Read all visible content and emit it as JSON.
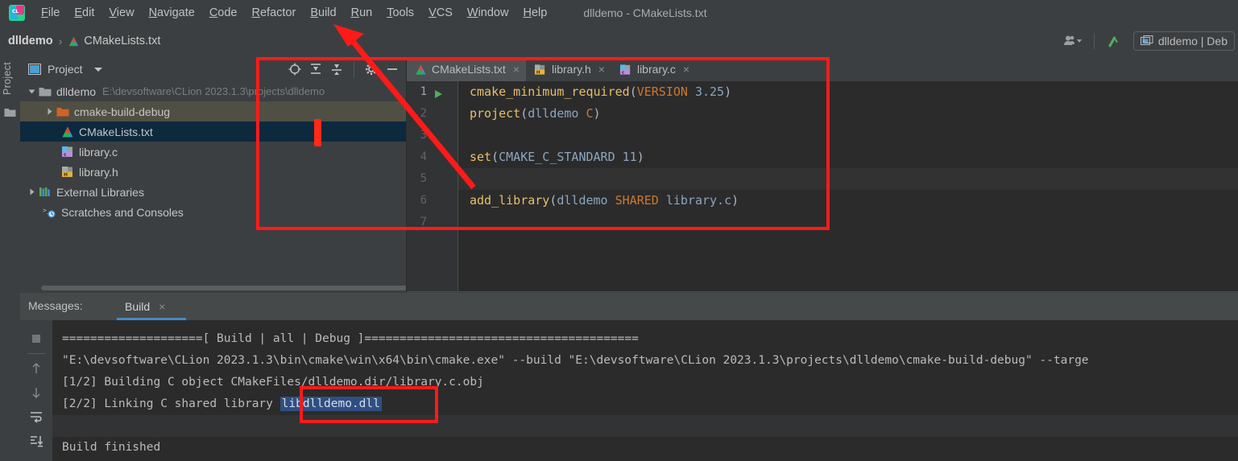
{
  "app": {
    "logo_icon": "clion-logo-icon",
    "window_title": "dlldemo - CMakeLists.txt"
  },
  "menubar": {
    "items": [
      {
        "label": "File",
        "mnemonic": "F"
      },
      {
        "label": "Edit",
        "mnemonic": "E"
      },
      {
        "label": "View",
        "mnemonic": "V"
      },
      {
        "label": "Navigate",
        "mnemonic": "N"
      },
      {
        "label": "Code",
        "mnemonic": "C"
      },
      {
        "label": "Refactor",
        "mnemonic": "R"
      },
      {
        "label": "Build",
        "mnemonic": "B"
      },
      {
        "label": "Run",
        "mnemonic": "R"
      },
      {
        "label": "Tools",
        "mnemonic": "T"
      },
      {
        "label": "VCS",
        "mnemonic": "V"
      },
      {
        "label": "Window",
        "mnemonic": "W"
      },
      {
        "label": "Help",
        "mnemonic": "H"
      }
    ]
  },
  "navbar": {
    "breadcrumbs": [
      "dlldemo",
      "CMakeLists.txt"
    ],
    "separator": "›",
    "file_icon": "cmake-file-icon",
    "right": {
      "account_icon": "account-dropdown-icon",
      "updates_icon": "green-arrow-icon",
      "run_config": {
        "icon": "run-config-icon",
        "label": "dlldemo | Deb"
      }
    }
  },
  "left_stripe": {
    "label": "Project",
    "folder_icon": "folder-icon"
  },
  "project_panel": {
    "title": "Project",
    "dropdown_icon": "chevron-down-icon",
    "view_icon": "project-view-icon",
    "toolbar": [
      {
        "name": "locate-icon",
        "glyph": "target"
      },
      {
        "name": "expand-all-icon",
        "glyph": "expand"
      },
      {
        "name": "collapse-all-icon",
        "glyph": "collapse"
      },
      {
        "name": "settings-gear-icon",
        "glyph": "gear"
      },
      {
        "name": "hide-panel-icon",
        "glyph": "minus"
      }
    ],
    "tree": [
      {
        "label": "dlldemo",
        "path": "E:\\devsoftware\\CLion 2023.1.3\\projects\\dlldemo",
        "icon": "project-folder-icon",
        "twisty": "expanded",
        "indent": 0,
        "state": "normal"
      },
      {
        "label": "cmake-build-debug",
        "path": "",
        "icon": "build-folder-icon",
        "twisty": "collapsed",
        "indent": 1,
        "state": "hover"
      },
      {
        "label": "CMakeLists.txt",
        "path": "",
        "icon": "cmake-file-icon",
        "twisty": "none",
        "indent": 2,
        "state": "selected"
      },
      {
        "label": "library.c",
        "path": "",
        "icon": "c-file-icon",
        "twisty": "none",
        "indent": 2,
        "state": "normal"
      },
      {
        "label": "library.h",
        "path": "",
        "icon": "h-file-icon",
        "twisty": "none",
        "indent": 2,
        "state": "normal"
      },
      {
        "label": "External Libraries",
        "path": "",
        "icon": "external-libraries-icon",
        "twisty": "collapsed",
        "indent": 0,
        "state": "normal"
      },
      {
        "label": "Scratches and Consoles",
        "path": "",
        "icon": "scratches-icon",
        "twisty": "none",
        "indent": 0,
        "state": "normal"
      }
    ]
  },
  "editor": {
    "tabs": [
      {
        "label": "CMakeLists.txt",
        "icon": "cmake-file-icon",
        "active": true,
        "close": "×"
      },
      {
        "label": "library.h",
        "icon": "h-file-icon",
        "active": false,
        "close": "×"
      },
      {
        "label": "library.c",
        "icon": "c-file-icon",
        "active": false,
        "close": "×"
      }
    ],
    "gutter": {
      "run_marker_icon": "run-gutter-icon",
      "line_numbers": [
        "1",
        "2",
        "3",
        "4",
        "5",
        "6",
        "7"
      ]
    },
    "lines": [
      {
        "n": 1,
        "highlight": false,
        "tokens": [
          {
            "t": "cmake_minimum_required",
            "c": "fn"
          },
          {
            "t": "(",
            "c": "p"
          },
          {
            "t": "VERSION",
            "c": "kw"
          },
          {
            "t": " ",
            "c": "p"
          },
          {
            "t": "3.25",
            "c": "num"
          },
          {
            "t": ")",
            "c": "p"
          }
        ]
      },
      {
        "n": 2,
        "highlight": false,
        "tokens": [
          {
            "t": "project",
            "c": "fn"
          },
          {
            "t": "(",
            "c": "p"
          },
          {
            "t": "dlldemo",
            "c": "id"
          },
          {
            "t": " ",
            "c": "p"
          },
          {
            "t": "C",
            "c": "kw"
          },
          {
            "t": ")",
            "c": "p"
          }
        ]
      },
      {
        "n": 3,
        "highlight": false,
        "tokens": []
      },
      {
        "n": 4,
        "highlight": false,
        "tokens": [
          {
            "t": "set",
            "c": "fn"
          },
          {
            "t": "(",
            "c": "p"
          },
          {
            "t": "CMAKE_C_STANDARD",
            "c": "id"
          },
          {
            "t": " ",
            "c": "p"
          },
          {
            "t": "11",
            "c": "num"
          },
          {
            "t": ")",
            "c": "p"
          }
        ]
      },
      {
        "n": 5,
        "highlight": true,
        "tokens": []
      },
      {
        "n": 6,
        "highlight": false,
        "tokens": [
          {
            "t": "add_library",
            "c": "fn"
          },
          {
            "t": "(",
            "c": "p"
          },
          {
            "t": "dlldemo",
            "c": "id"
          },
          {
            "t": " ",
            "c": "p"
          },
          {
            "t": "SHARED",
            "c": "kw"
          },
          {
            "t": " ",
            "c": "p"
          },
          {
            "t": "library.c",
            "c": "id"
          },
          {
            "t": ")",
            "c": "p"
          }
        ]
      },
      {
        "n": 7,
        "highlight": false,
        "tokens": []
      }
    ]
  },
  "build_panel": {
    "messages_label": "Messages:",
    "tab_label": "Build",
    "tab_close": "×",
    "toolbar": [
      {
        "name": "stop-build-icon",
        "glyph": "square"
      },
      {
        "name": "prev-problem-icon",
        "glyph": "arrow-up"
      },
      {
        "name": "next-problem-icon",
        "glyph": "arrow-down"
      },
      {
        "name": "soft-wrap-icon",
        "glyph": "wrap"
      },
      {
        "name": "scroll-to-end-icon",
        "glyph": "scroll-end"
      }
    ],
    "console_lines": [
      {
        "band": false,
        "text": "====================[ Build | all | Debug ]======================================="
      },
      {
        "band": false,
        "text": "\"E:\\devsoftware\\CLion 2023.1.3\\bin\\cmake\\win\\x64\\bin\\cmake.exe\" --build \"E:\\devsoftware\\CLion 2023.1.3\\projects\\dlldemo\\cmake-build-debug\" --targe"
      },
      {
        "band": false,
        "text": "[1/2] Building C object CMakeFiles/dlldemo.dir/library.c.obj"
      },
      {
        "band": false,
        "prefix": "[2/2] Linking C shared library ",
        "selected": "libdlldemo.dll",
        "suffix": ""
      },
      {
        "band": true,
        "text": ""
      },
      {
        "band": false,
        "text": "Build finished"
      }
    ]
  },
  "annotations": {
    "accent_color": "#ff1a1a",
    "rect_editor_region": "highlight-cmakelists-editor",
    "rect_dll_output": "highlight-libdlldemo-dll",
    "arrow_to_build_menu": "arrow-pointing-to-build-menu",
    "vertical_bar": "red-vertical-marker"
  }
}
